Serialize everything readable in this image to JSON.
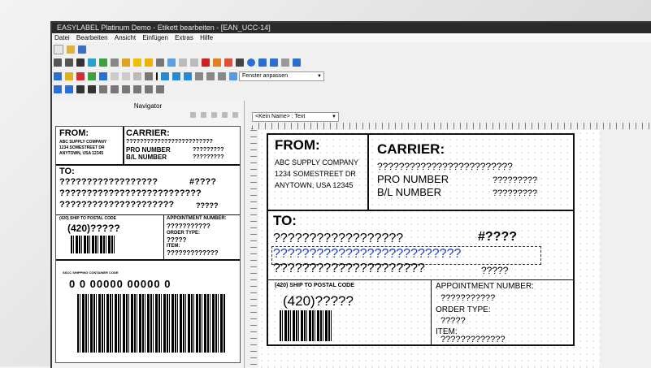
{
  "window": {
    "title": "EASYLABEL Platinum Demo - Etikett bearbeiten - [EAN_UCC-14]"
  },
  "menu": [
    "Datei",
    "Bearbeiten",
    "Ansicht",
    "Einfügen",
    "Extras",
    "Hilfe"
  ],
  "toolbar": {
    "zoom_select": "Fenster anpassen"
  },
  "navigator": {
    "title": "Navigator"
  },
  "editor": {
    "element_select": "<Kein Name> : Text"
  },
  "label": {
    "from": "FROM:",
    "from_company": "ABC SUPPLY COMPANY",
    "from_street": "1234 SOMESTREET DR",
    "from_city": "ANYTOWN, USA 12345",
    "carrier": "CARRIER:",
    "carrier_value": "?????????????????????????",
    "pro_number": "PRO NUMBER",
    "pro_value": "?????????",
    "bl_number": "B/L NUMBER",
    "bl_value": "?????????",
    "to": "TO:",
    "to_line1": "??????????????????",
    "to_hash": "#????",
    "to_line2": "??????????????????????????",
    "to_line3": "?????????????????????",
    "to_line3b": "?????",
    "ship_postal": "(420) SHIP TO POSTAL CODE",
    "postal_value": "(420)?????",
    "appointment": "APPOINTMENT NUMBER:",
    "appointment_value": "???????????",
    "order_type": "ORDER TYPE:",
    "order_value": "?????",
    "item": "ITEM:",
    "item_value": "?????????????",
    "sscc_caption": "SSCC SHIPPING CONTAINER CODE",
    "sscc_number": "0 0 00000 00000 0"
  }
}
